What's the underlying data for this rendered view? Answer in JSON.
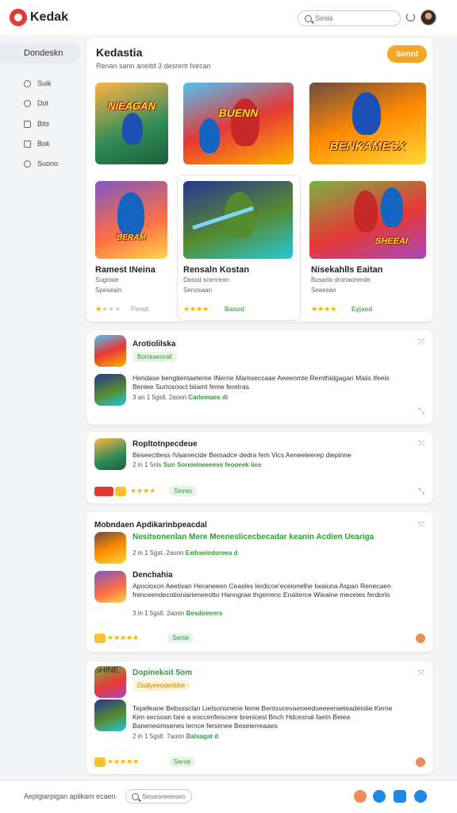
{
  "header": {
    "logo_text": "Kedak",
    "search_placeholder": "Sesla"
  },
  "sidebar": {
    "active_label": "Dondeskn",
    "items": [
      {
        "label": "Suik",
        "icon": "circle-icon"
      },
      {
        "label": "Dot",
        "icon": "chat-icon"
      },
      {
        "label": "Bits",
        "icon": "grid-icon"
      },
      {
        "label": "Bok",
        "icon": "book-icon"
      },
      {
        "label": "Suono",
        "icon": "sound-icon"
      }
    ]
  },
  "featured": {
    "title": "Kedastia",
    "subtitle": "Renan sann aneitd 3 desrent Ivecan",
    "button_label": "Sonnt",
    "thumb_texts": [
      "NIEAGAN",
      "BUENN",
      "BENKAMESX"
    ],
    "games": [
      {
        "title": "Ramest INeina",
        "line1": "Sugnaie",
        "line2": "Speseain",
        "rating_text": "Peosit",
        "stars": 1
      },
      {
        "title": "Rensaln Kostan",
        "line1": "Dassd scenrean",
        "line2": "Senosaan",
        "rating_text": "Banod",
        "stars": 4
      },
      {
        "title": "Nisekahlls Eaitan",
        "line1": "Bosarla dronaonerde",
        "line2": "Seaesan",
        "rating_text": "Eyjand",
        "stars": 4
      }
    ],
    "bottom_thumb_texts": [
      "BERAM",
      "",
      "SHEEAI"
    ]
  },
  "list": [
    {
      "title": "Arotiolilska",
      "pill": "Borreaeoralt",
      "desc": "Hendase bengtientaeteme INerne Mamseccaae Aeeenmte Remthidgagan Maiis Ifeeis Beniee Surtosooct biiamt feme feretras.",
      "meta": "3 an 1 5gstl. 2aoon",
      "meta_green": "Carlemaes di"
    },
    {
      "title": "Ropltotnpecdeue",
      "pill": "",
      "desc": "Beseecitiess IVaaniecide Bemadce dedra fem Vics Aeneeleerep diepinne",
      "meta": "2 in 1 5nls",
      "meta_green": "Sun Soreieineeeeve feooeek iies",
      "rating_text": "Sinren"
    },
    {
      "header": "Mobndaen Apdikarinbpeacdal",
      "green_line": "Nesitsonenlan Mere Meeneslicecbecadar keanin Acdien Ueariga",
      "meta_a": "2 in 1 Sgst. 2aoon",
      "meta_a_green": "Ewhaeiodoreea d",
      "sub_title": "Denchahia",
      "desc": "Apocioxon Aeetivan Heraneeen Ceasles lerdicoe'eceionelhe Iwaiuna Aspan Renecaen frenceendecotioniarieneeotto Hanngrae thgerrenc Enaiterce Wieaine mecetes ferdorlo",
      "meta_b": "3 in 1 5gstl. 2aoon",
      "meta_b_green": "Besdoeenrs",
      "rating_text": "Seroe"
    },
    {
      "title": "Dopinekoit 5om",
      "pill": "Dsdiyeeodenbhe",
      "thumb_text": "SHINE",
      "desc": "Tepefeane Bebsssclan Lietsononene feme Bentsvcevaeneedoeeeeraeteadeiolie Kerne Ken secsoan fare a eoccenfeiscere brenicesl Bnch Hdcesnal faetn Beiea Banenesimsenes lernce fersimee Beseierreaaes",
      "meta": "2 in 1 5gstl. 7aoon",
      "meta_green": "Balsagat d",
      "rating_text": "Seroe"
    }
  ],
  "footer": {
    "text": "Aeplgiarpigan aplikam ecaen.",
    "search_placeholder": "Seseoreeesen"
  },
  "colors": {
    "accent_orange": "#f5a623",
    "star": "#f5b400",
    "green": "#2e9c3a",
    "brand_red": "#e53935"
  }
}
